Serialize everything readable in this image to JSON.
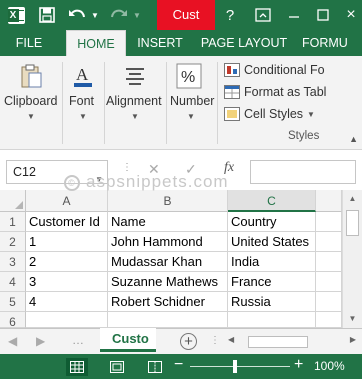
{
  "title_bar": {
    "tab_text": "Cust",
    "help_glyph": "?",
    "close_glyph": "×"
  },
  "ribbon_tabs": [
    "FILE",
    "HOME",
    "INSERT",
    "PAGE LAYOUT",
    "FORMU"
  ],
  "ribbon_groups": {
    "clipboard": "Clipboard",
    "font": "Font",
    "alignment": "Alignment",
    "number": "Number",
    "styles_items": [
      "Conditional Fo",
      "Format as Tabl",
      "Cell Styles"
    ],
    "styles_label": "Styles"
  },
  "formula_bar": {
    "name_box": "C12",
    "fx": "fx",
    "formula_value": ""
  },
  "watermark": "aspsnippets.com",
  "columns": [
    "A",
    "B",
    "C"
  ],
  "selected_column": "C",
  "rows": [
    {
      "num": "1",
      "a": "Customer Id",
      "b": "Name",
      "c": "Country"
    },
    {
      "num": "2",
      "a": "1",
      "b": "John Hammond",
      "c": "United States"
    },
    {
      "num": "3",
      "a": "2",
      "b": "Mudassar Khan",
      "c": "India"
    },
    {
      "num": "4",
      "a": "3",
      "b": "Suzanne Mathews",
      "c": "France"
    },
    {
      "num": "5",
      "a": "4",
      "b": "Robert Schidner",
      "c": "Russia"
    },
    {
      "num": "6",
      "a": "",
      "b": "",
      "c": ""
    }
  ],
  "sheet_tab": "Custo",
  "add_sheet_glyph": "+",
  "status_bar": {
    "zoom_minus": "−",
    "zoom_plus": "+",
    "zoom_level": "100%",
    "zoom_fraction": 0.45
  },
  "colors": {
    "excel_green": "#217346",
    "title_tab_red": "#e81123"
  }
}
